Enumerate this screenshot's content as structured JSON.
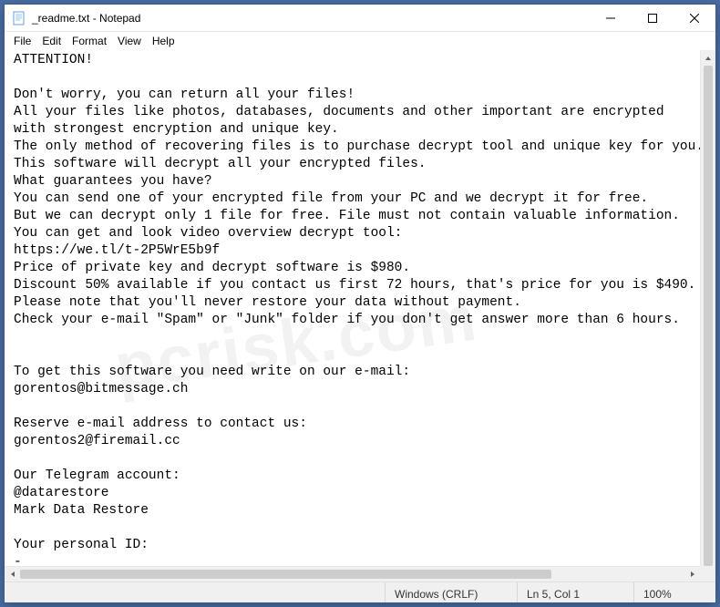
{
  "titlebar": {
    "title": "_readme.txt - Notepad"
  },
  "menu": {
    "file": "File",
    "edit": "Edit",
    "format": "Format",
    "view": "View",
    "help": "Help"
  },
  "content": {
    "text": "ATTENTION!\n\nDon't worry, you can return all your files!\nAll your files like photos, databases, documents and other important are encrypted\nwith strongest encryption and unique key.\nThe only method of recovering files is to purchase decrypt tool and unique key for you.\nThis software will decrypt all your encrypted files.\nWhat guarantees you have?\nYou can send one of your encrypted file from your PC and we decrypt it for free.\nBut we can decrypt only 1 file for free. File must not contain valuable information.\nYou can get and look video overview decrypt tool:\nhttps://we.tl/t-2P5WrE5b9f\nPrice of private key and decrypt software is $980.\nDiscount 50% available if you contact us first 72 hours, that's price for you is $490.\nPlease note that you'll never restore your data without payment.\nCheck your e-mail \"Spam\" or \"Junk\" folder if you don't get answer more than 6 hours.\n\n\nTo get this software you need write on our e-mail:\ngorentos@bitmessage.ch\n\nReserve e-mail address to contact us:\ngorentos2@firemail.cc\n\nOur Telegram account:\n@datarestore\nMark Data Restore\n\nYour personal ID:\n-"
  },
  "statusbar": {
    "encoding": "Windows (CRLF)",
    "position": "Ln 5, Col 1",
    "zoom": "100%"
  },
  "watermark": "pcrisk.com"
}
